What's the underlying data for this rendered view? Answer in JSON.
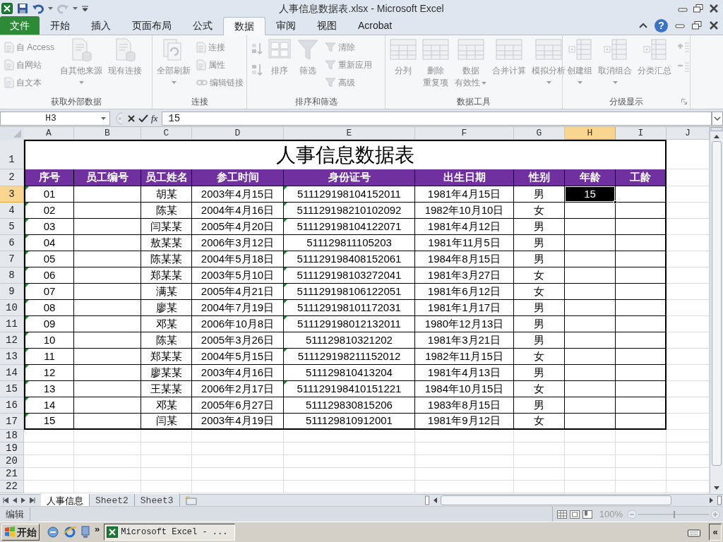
{
  "window": {
    "title": "人事信息数据表.xlsx - Microsoft Excel"
  },
  "ribbon_tabs": [
    {
      "label": "文件",
      "kind": "file",
      "selected": false
    },
    {
      "label": "开始",
      "kind": "tab",
      "selected": false
    },
    {
      "label": "插入",
      "kind": "tab",
      "selected": false
    },
    {
      "label": "页面布局",
      "kind": "tab",
      "selected": false
    },
    {
      "label": "公式",
      "kind": "tab",
      "selected": false
    },
    {
      "label": "数据",
      "kind": "tab",
      "selected": true
    },
    {
      "label": "审阅",
      "kind": "tab",
      "selected": false
    },
    {
      "label": "视图",
      "kind": "tab",
      "selected": false
    },
    {
      "label": "Acrobat",
      "kind": "tab",
      "selected": false
    }
  ],
  "help": "?",
  "ribbon_groups": [
    {
      "label": "获取外部数据",
      "items": [
        {
          "kind": "small",
          "label": "自 Access",
          "disabled": true
        },
        {
          "kind": "small",
          "label": "自网站",
          "disabled": true
        },
        {
          "kind": "small",
          "label": "自文本",
          "disabled": true
        },
        {
          "kind": "large",
          "lines": [
            "自其他来源"
          ],
          "dropdown": true,
          "disabled": true
        },
        {
          "kind": "large",
          "lines": [
            "现有连接"
          ],
          "dropdown": false,
          "disabled": true
        }
      ]
    },
    {
      "label": "连接",
      "items": [
        {
          "kind": "large",
          "lines": [
            "全部刷新"
          ],
          "dropdown": true,
          "disabled": true
        },
        {
          "kind": "small",
          "label": "连接",
          "disabled": true
        },
        {
          "kind": "small",
          "label": "属性",
          "disabled": true
        },
        {
          "kind": "small",
          "label": "编辑链接",
          "disabled": true
        }
      ]
    },
    {
      "label": "排序和筛选",
      "items": [
        {
          "kind": "icon",
          "disabled": true
        },
        {
          "kind": "icon",
          "disabled": true
        },
        {
          "kind": "large",
          "lines": [
            "排序"
          ],
          "dropdown": false,
          "disabled": true
        },
        {
          "kind": "large",
          "lines": [
            "筛选"
          ],
          "dropdown": false,
          "disabled": true
        },
        {
          "kind": "small",
          "label": "清除",
          "disabled": true
        },
        {
          "kind": "small",
          "label": "重新应用",
          "disabled": true
        },
        {
          "kind": "small",
          "label": "高级",
          "disabled": true
        }
      ]
    },
    {
      "label": "数据工具",
      "items": [
        {
          "kind": "large",
          "lines": [
            "分列"
          ],
          "dropdown": false,
          "disabled": true
        },
        {
          "kind": "large",
          "lines": [
            "删除",
            "重复项"
          ],
          "dropdown": false,
          "disabled": true
        },
        {
          "kind": "large",
          "lines": [
            "数据",
            "有效性"
          ],
          "dropdown": true,
          "disabled": true
        },
        {
          "kind": "large",
          "lines": [
            "合并计算"
          ],
          "dropdown": false,
          "disabled": true
        },
        {
          "kind": "large",
          "lines": [
            "模拟分析"
          ],
          "dropdown": true,
          "disabled": true
        }
      ]
    },
    {
      "label": "分级显示",
      "items": [
        {
          "kind": "large",
          "lines": [
            "创建组"
          ],
          "dropdown": true,
          "disabled": true
        },
        {
          "kind": "large",
          "lines": [
            "取消组合"
          ],
          "dropdown": true,
          "disabled": true
        },
        {
          "kind": "large",
          "lines": [
            "分类汇总"
          ],
          "dropdown": false,
          "disabled": true
        },
        {
          "kind": "icon",
          "disabled": true
        },
        {
          "kind": "icon",
          "disabled": true
        }
      ]
    }
  ],
  "formula_bar": {
    "name_box": "H3",
    "fx": "fx",
    "value": "15"
  },
  "columns": [
    {
      "label": "A",
      "selected": false
    },
    {
      "label": "B",
      "selected": false
    },
    {
      "label": "C",
      "selected": false
    },
    {
      "label": "D",
      "selected": false
    },
    {
      "label": "E",
      "selected": false
    },
    {
      "label": "F",
      "selected": false
    },
    {
      "label": "G",
      "selected": false
    },
    {
      "label": "H",
      "selected": true
    },
    {
      "label": "I",
      "selected": false
    },
    {
      "label": "J",
      "selected": false
    }
  ],
  "sheet_title": {
    "number": "1",
    "text": "人事信息数据表"
  },
  "table_header": {
    "number": "2",
    "labels": [
      "序号",
      "员工编号",
      "员工姓名",
      "参工时间",
      "身份证号",
      "出生日期",
      "性别",
      "年龄",
      "工龄"
    ]
  },
  "rows": [
    {
      "number": "3",
      "selected": true,
      "no": "01",
      "no_flag": true,
      "name": "胡某",
      "joined": "2003年4月15日",
      "id": "511129198104152011",
      "id_flag": true,
      "birth": "1981年4月15日",
      "sex": "男",
      "age": "15"
    },
    {
      "number": "4",
      "selected": false,
      "no": "02",
      "no_flag": true,
      "name": "陈某",
      "joined": "2004年4月16日",
      "id": "511129198210102092",
      "id_flag": true,
      "birth": "1982年10月10日",
      "sex": "女"
    },
    {
      "number": "5",
      "selected": false,
      "no": "03",
      "no_flag": true,
      "name": "闫某某",
      "joined": "2005年4月20日",
      "id": "511129198104122071",
      "id_flag": true,
      "birth": "1981年4月12日",
      "sex": "男"
    },
    {
      "number": "6",
      "selected": false,
      "no": "04",
      "no_flag": true,
      "name": "敖某某",
      "joined": "2006年3月12日",
      "id": "511129811105203",
      "id_flag": false,
      "birth": "1981年11月5日",
      "sex": "男"
    },
    {
      "number": "7",
      "selected": false,
      "no": "05",
      "no_flag": true,
      "name": "陈某某",
      "joined": "2004年5月18日",
      "id": "511129198408152061",
      "id_flag": true,
      "birth": "1984年8月15日",
      "sex": "男"
    },
    {
      "number": "8",
      "selected": false,
      "no": "06",
      "no_flag": true,
      "name": "郑某某",
      "joined": "2003年5月10日",
      "id": "511129198103272041",
      "id_flag": true,
      "birth": "1981年3月27日",
      "sex": "女"
    },
    {
      "number": "9",
      "selected": false,
      "no": "07",
      "no_flag": true,
      "name": "满某",
      "joined": "2005年4月21日",
      "id": "511129198106122051",
      "id_flag": true,
      "birth": "1981年6月12日",
      "sex": "女"
    },
    {
      "number": "10",
      "selected": false,
      "no": "08",
      "no_flag": true,
      "name": "廖某",
      "joined": "2004年7月19日",
      "id": "511129198101172031",
      "id_flag": true,
      "birth": "1981年1月17日",
      "sex": "男"
    },
    {
      "number": "11",
      "selected": false,
      "no": "09",
      "no_flag": true,
      "name": "邓某",
      "joined": "2006年10月8日",
      "id": "511129198012132011",
      "id_flag": true,
      "birth": "1980年12月13日",
      "sex": "男"
    },
    {
      "number": "12",
      "selected": false,
      "no": "10",
      "no_flag": true,
      "name": "陈某",
      "joined": "2005年3月26日",
      "id": "511129810321202",
      "id_flag": false,
      "birth": "1981年3月21日",
      "sex": "男"
    },
    {
      "number": "13",
      "selected": false,
      "no": "11",
      "no_flag": true,
      "name": "郑某某",
      "joined": "2004年5月15日",
      "id": "511129198211152012",
      "id_flag": true,
      "birth": "1982年11月15日",
      "sex": "女"
    },
    {
      "number": "14",
      "selected": false,
      "no": "12",
      "no_flag": true,
      "name": "廖某某",
      "joined": "2003年4月16日",
      "id": "511129810413204",
      "id_flag": false,
      "birth": "1981年4月13日",
      "sex": "男"
    },
    {
      "number": "15",
      "selected": false,
      "no": "13",
      "no_flag": true,
      "name": "王某某",
      "joined": "2006年2月17日",
      "id": "511129198410151221",
      "id_flag": true,
      "birth": "1984年10月15日",
      "sex": "女"
    },
    {
      "number": "16",
      "selected": false,
      "no": "14",
      "no_flag": true,
      "name": "邓某",
      "joined": "2005年6月27日",
      "id": "511129830815206",
      "id_flag": false,
      "birth": "1983年8月15日",
      "sex": "男"
    },
    {
      "number": "17",
      "selected": false,
      "no": "15",
      "no_flag": true,
      "name": "闫某",
      "joined": "2003年4月19日",
      "id": "511129810912001",
      "id_flag": false,
      "birth": "1981年9月12日",
      "sex": "女"
    }
  ],
  "empty_rows": [
    "18",
    "19",
    "20",
    "21",
    "22"
  ],
  "sheet_tabs": [
    {
      "label": "人事信息",
      "selected": true
    },
    {
      "label": "Sheet2",
      "selected": false
    },
    {
      "label": "Sheet3",
      "selected": false
    }
  ],
  "status_bar": {
    "mode": "编辑",
    "zoom": "100%",
    "zoom_slider": {
      "level": 0.5
    }
  },
  "taskbar": {
    "start": "开始",
    "more": "»",
    "tasks": [
      {
        "label": "Microsoft Excel - ..."
      }
    ],
    "show_hidden": "«"
  }
}
